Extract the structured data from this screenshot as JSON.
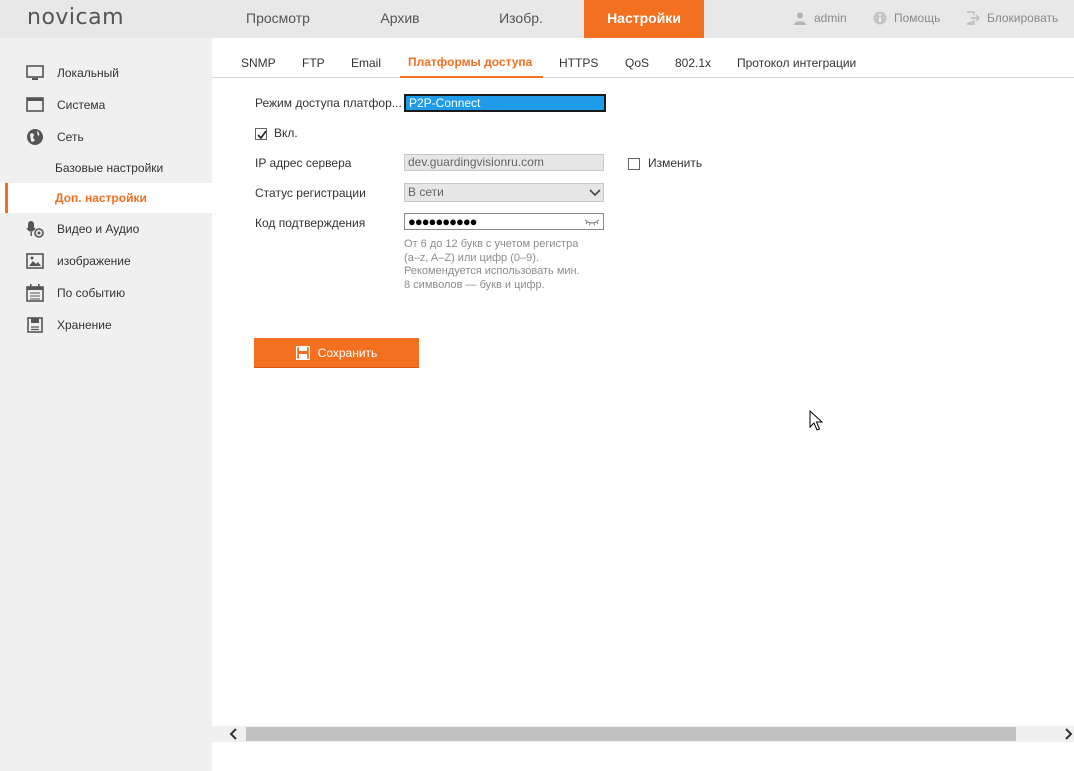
{
  "brand": {
    "logo_text": "novicam"
  },
  "nav": {
    "items": [
      {
        "label": "Просмотр"
      },
      {
        "label": "Архив"
      },
      {
        "label": "Изобр."
      },
      {
        "label": "Настройки"
      }
    ],
    "active_index": 3
  },
  "top_right": {
    "user": "admin",
    "help": "Помощь",
    "lock": "Блокировать"
  },
  "sidebar": {
    "items": [
      {
        "label": "Локальный",
        "icon": "monitor-icon"
      },
      {
        "label": "Система",
        "icon": "system-window-icon"
      },
      {
        "label": "Сеть",
        "icon": "globe-icon"
      },
      {
        "label": "Базовые настройки",
        "sub": true
      },
      {
        "label": "Доп. настройки",
        "sub": true,
        "active": true
      },
      {
        "label": "Видео и Аудио",
        "icon": "microphone-icon"
      },
      {
        "label": "изображение",
        "icon": "image-icon"
      },
      {
        "label": "По событию",
        "icon": "calendar-icon"
      },
      {
        "label": "Хранение",
        "icon": "storage-icon"
      }
    ]
  },
  "tabs": [
    {
      "label": "SNMP"
    },
    {
      "label": "FTP"
    },
    {
      "label": "Email"
    },
    {
      "label": "Платформы доступа",
      "active": true
    },
    {
      "label": "HTTPS"
    },
    {
      "label": "QoS"
    },
    {
      "label": "802.1x"
    },
    {
      "label": "Протокол интеграции"
    }
  ],
  "form": {
    "mode_label": "Режим доступа платфор...",
    "mode_value": "P2P-Connect",
    "enable_label": "Вкл.",
    "enable_checked": true,
    "server_label": "IP адрес сервера",
    "server_value": "dev.guardingvisionru.com",
    "change_label": "Изменить",
    "change_checked": false,
    "status_label": "Статус регистрации",
    "status_value": "В сети",
    "code_label": "Код подтверждения",
    "code_value": "●●●●●●●●●●",
    "hint_lines": [
      "От 6 до 12 букв с учетом регистра",
      "(a–z, A–Z) или цифр (0–9).",
      "Рекомендуется использовать мин.",
      "8 символов — букв и цифр."
    ],
    "save_label": "Сохранить"
  },
  "colors": {
    "accent": "#f37021",
    "select_highlight": "#1e9be9",
    "topbar": "#e8e8e8",
    "sidebar": "#f0f0f0"
  }
}
